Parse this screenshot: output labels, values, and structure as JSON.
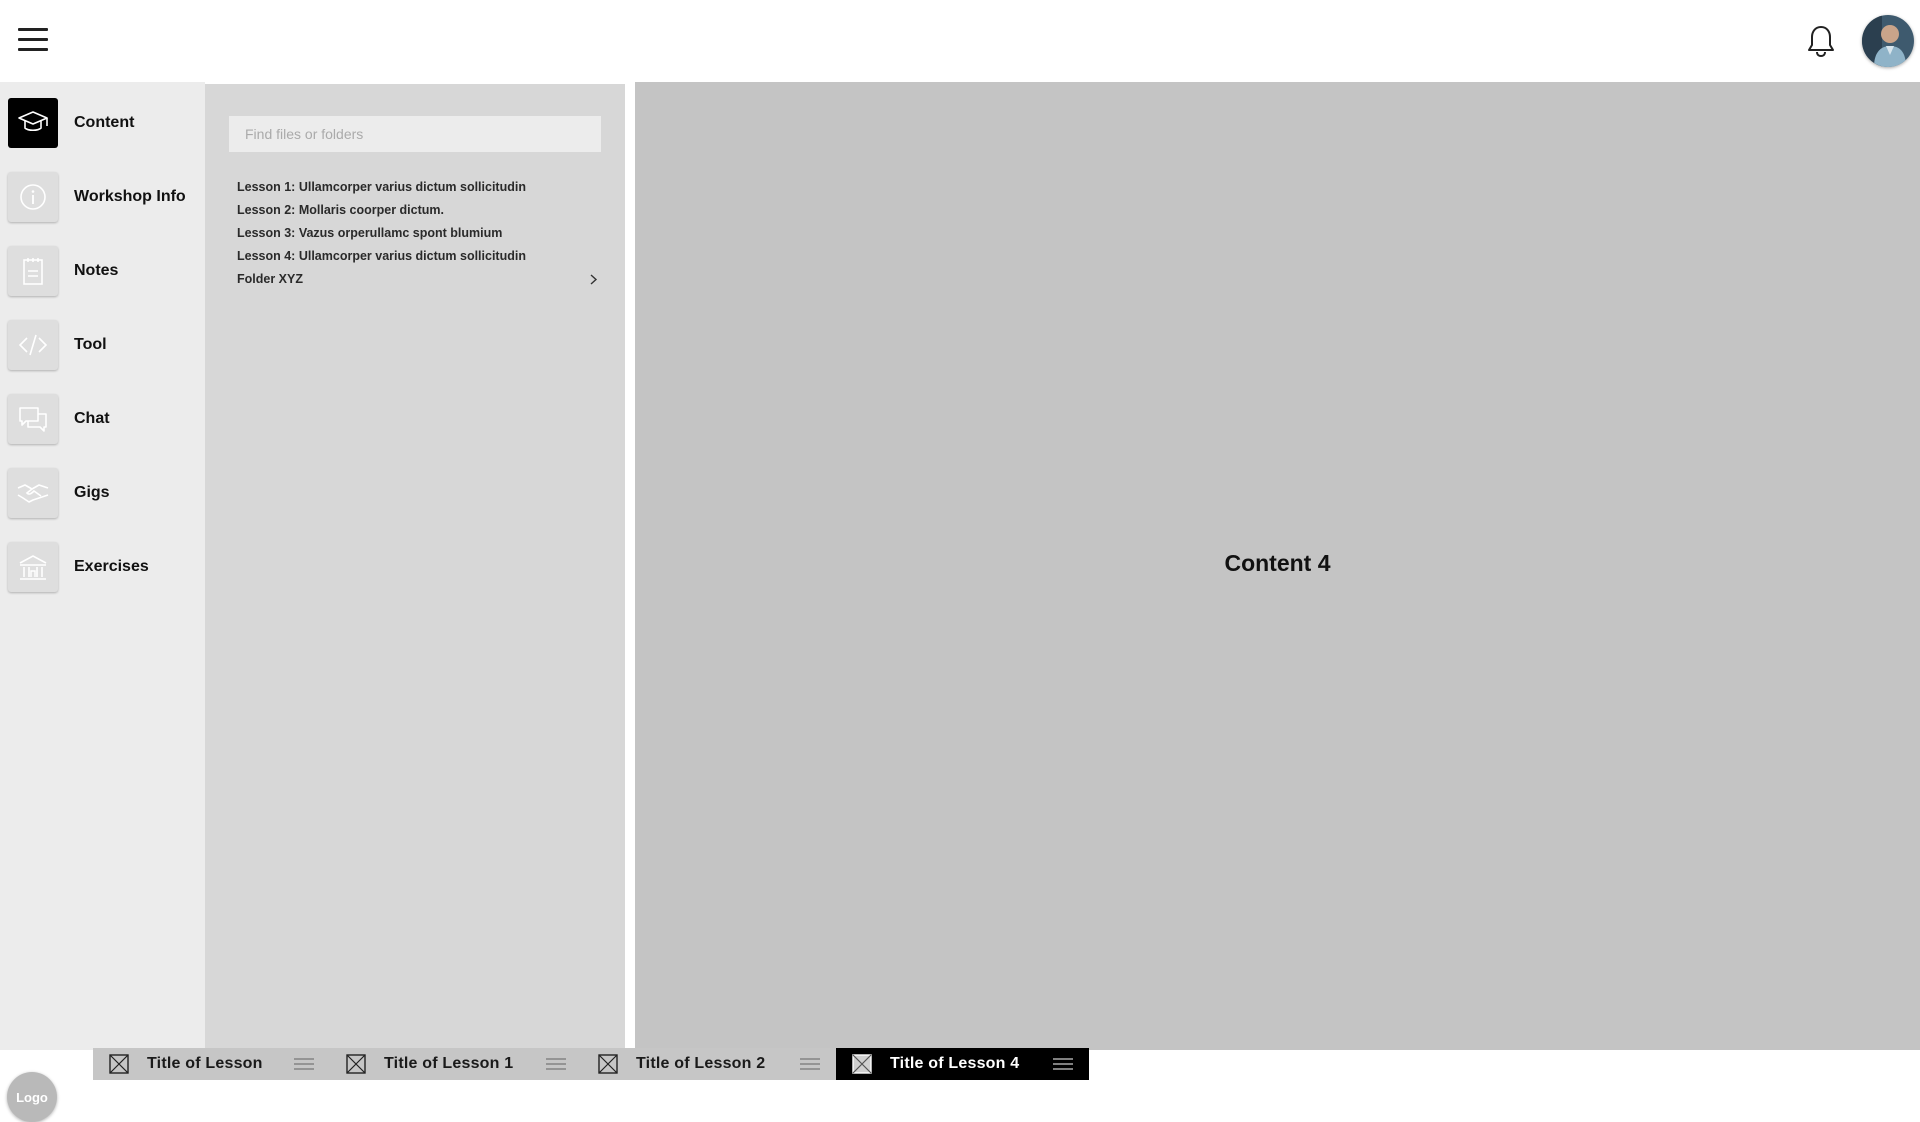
{
  "topbar": {
    "menu_icon": "hamburger-icon",
    "notification_icon": "bell-icon",
    "avatar_icon": "user-avatar"
  },
  "nav": {
    "items": [
      {
        "label": "Content",
        "icon": "graduation-cap-icon",
        "active": true
      },
      {
        "label": "Workshop Info",
        "icon": "info-icon",
        "active": false
      },
      {
        "label": "Notes",
        "icon": "notepad-icon",
        "active": false
      },
      {
        "label": "Tool",
        "icon": "code-icon",
        "active": false
      },
      {
        "label": "Chat",
        "icon": "chat-bubbles-icon",
        "active": false
      },
      {
        "label": "Gigs",
        "icon": "handshake-icon",
        "active": false
      },
      {
        "label": "Exercises",
        "icon": "gym-building-icon",
        "active": false
      }
    ],
    "logo": "Logo"
  },
  "files": {
    "search_placeholder": "Find files or folders",
    "items": [
      "Lesson 1: Ullamcorper varius dictum sollicitudin",
      "Lesson 2: Mollaris coorper dictum.",
      "Lesson 3: Vazus orperullamc spont blumium",
      "Lesson 4: Ullamcorper varius dictum sollicitudin",
      "Folder XYZ"
    ]
  },
  "main": {
    "title": "Content 4"
  },
  "tabs": [
    {
      "label": "Title of Lesson",
      "active": false
    },
    {
      "label": "Title of Lesson 1",
      "active": false
    },
    {
      "label": "Title of Lesson 2",
      "active": false
    },
    {
      "label": "Title of Lesson 4",
      "active": true
    }
  ],
  "colors": {
    "nav_bg": "#ececec",
    "panel_bg": "#d7d7d7",
    "content_bg": "#c4c4c4",
    "active": "#000000"
  }
}
